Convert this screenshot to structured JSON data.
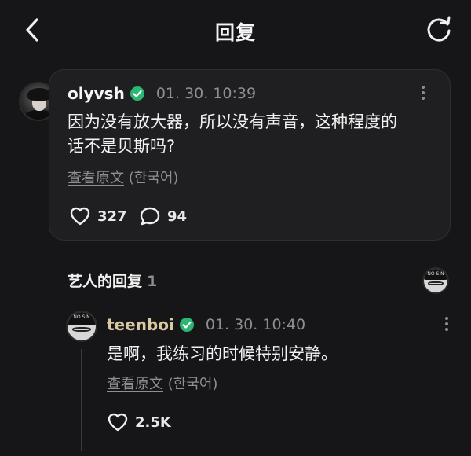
{
  "header": {
    "title": "回复",
    "back_icon": "chevron-left-icon",
    "refresh_icon": "refresh-icon"
  },
  "comment": {
    "username": "olyvsh",
    "verified": true,
    "timestamp": "01. 30. 10:39",
    "text_line1": "因为没有放大器，所以没有声音，这种程度的",
    "text_line2": "话不是贝斯吗?",
    "translate_link": "查看原文",
    "translate_lang": "(한국어)",
    "likes": "327",
    "replies": "94"
  },
  "artist_section": {
    "title": "艺人的回复",
    "count": "1",
    "cap_text": "NO SIN"
  },
  "reply": {
    "username": "teenboi",
    "verified": true,
    "timestamp": "01. 30. 10:40",
    "text": "是啊，我练习的时候特别安静。",
    "translate_link": "查看原文",
    "translate_lang": "(한국어)",
    "likes": "2.5K"
  },
  "colors": {
    "background": "#161618",
    "card": "#1f1f21",
    "muted": "#8e8e93",
    "comment_username": "#f5f5f5",
    "reply_username": "#d8c9a0",
    "verified": "#2bb673"
  }
}
